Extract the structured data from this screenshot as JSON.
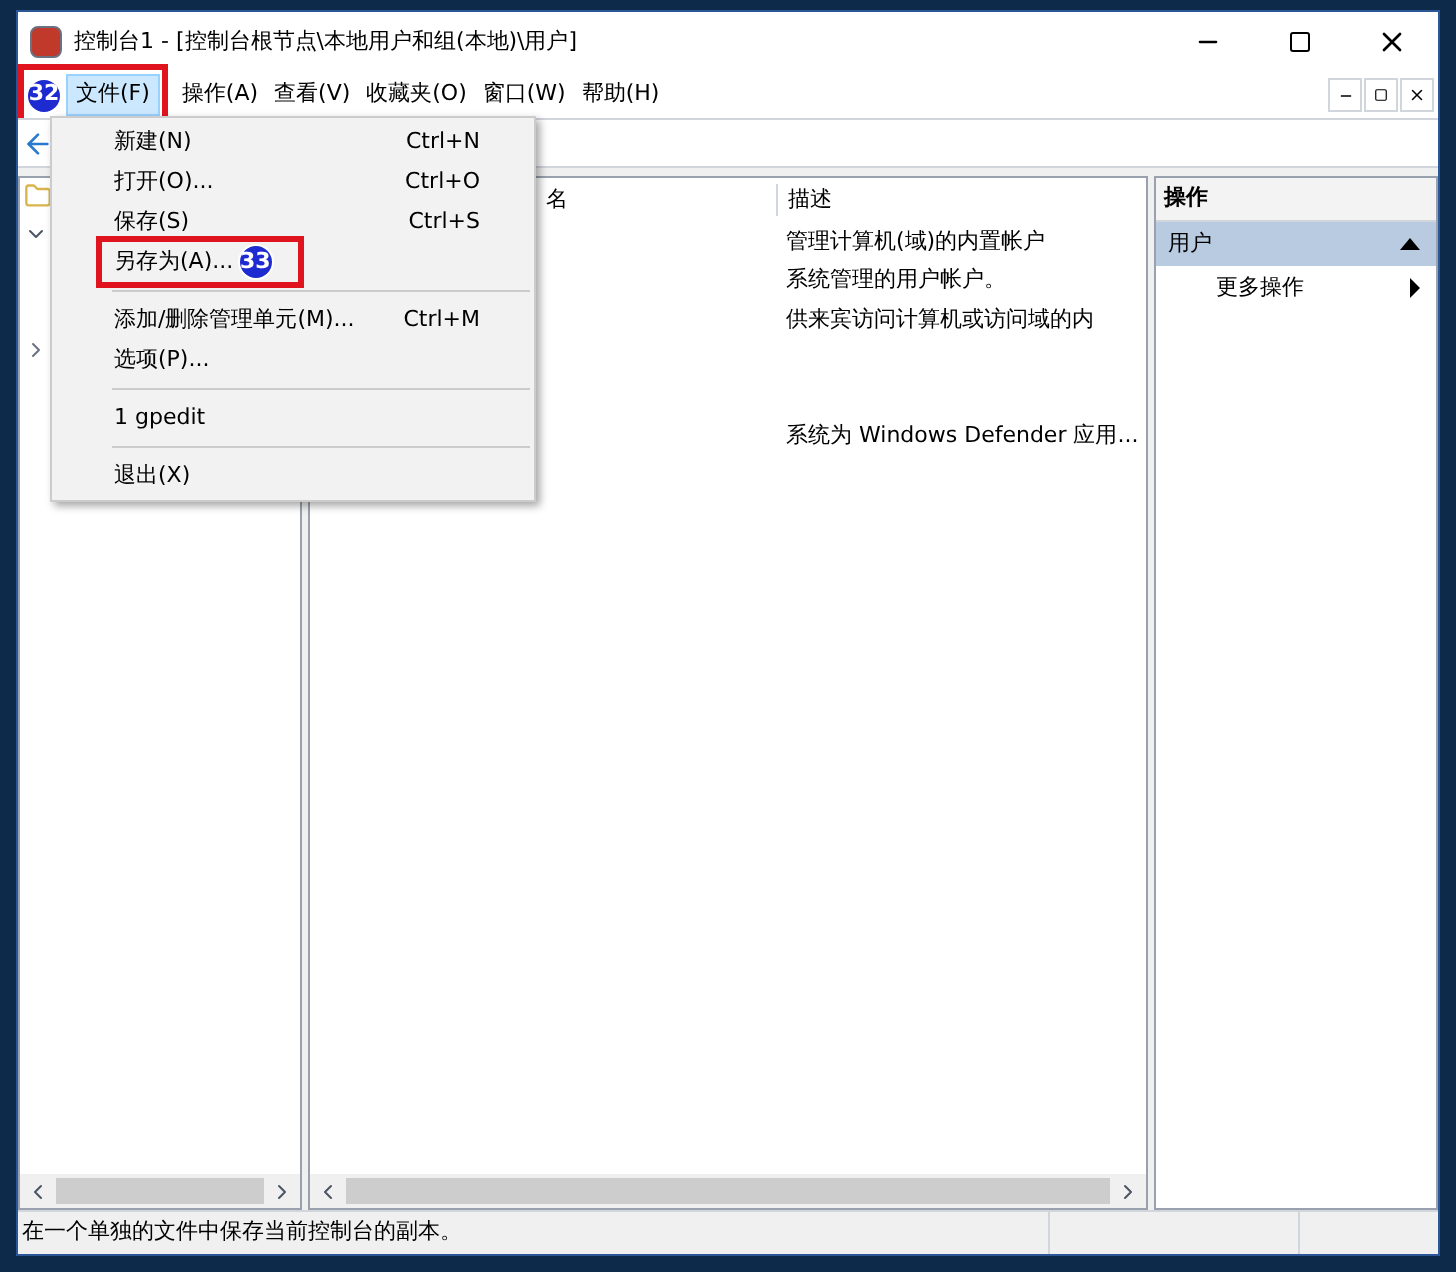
{
  "window": {
    "title": "控制台1 - [控制台根节点\\本地用户和组(本地)\\用户]"
  },
  "menu_bar": [
    {
      "label": "文件(F)",
      "selected": true,
      "callout": "32"
    },
    {
      "label": "操作(A)",
      "selected": false
    },
    {
      "label": "查看(V)",
      "selected": false
    },
    {
      "label": "收藏夹(O)",
      "selected": false
    },
    {
      "label": "窗口(W)",
      "selected": false
    },
    {
      "label": "帮助(H)",
      "selected": false
    }
  ],
  "file_menu": [
    {
      "kind": "item",
      "label": "新建(N)",
      "shortcut": "Ctrl+N"
    },
    {
      "kind": "item",
      "label": "打开(O)...",
      "shortcut": "Ctrl+O"
    },
    {
      "kind": "item",
      "label": "保存(S)",
      "shortcut": "Ctrl+S"
    },
    {
      "kind": "item",
      "label": "另存为(A)...",
      "callout": "33"
    },
    {
      "kind": "separator"
    },
    {
      "kind": "item",
      "label": "添加/删除管理单元(M)...",
      "shortcut": "Ctrl+M"
    },
    {
      "kind": "item",
      "label": "选项(P)..."
    },
    {
      "kind": "separator"
    },
    {
      "kind": "item",
      "label": "1 gpedit"
    },
    {
      "kind": "separator"
    },
    {
      "kind": "item",
      "label": "退出(X)"
    }
  ],
  "list": {
    "columns": [
      "名",
      "描述"
    ],
    "rows": [
      {
        "description": "管理计算机(域)的内置帐户"
      },
      {
        "description": "系统管理的用户帐户。"
      },
      {
        "description": "供来宾访问计算机或访问域的内"
      },
      {},
      {},
      {
        "description": "系统为 Windows Defender 应用..."
      }
    ]
  },
  "actions": {
    "title": "操作",
    "sections": [
      {
        "label": "用户",
        "expanded": true,
        "items": [
          "更多操作"
        ]
      }
    ]
  },
  "status_bar": {
    "text": "在一个单独的文件中保存当前控制台的副本。"
  }
}
